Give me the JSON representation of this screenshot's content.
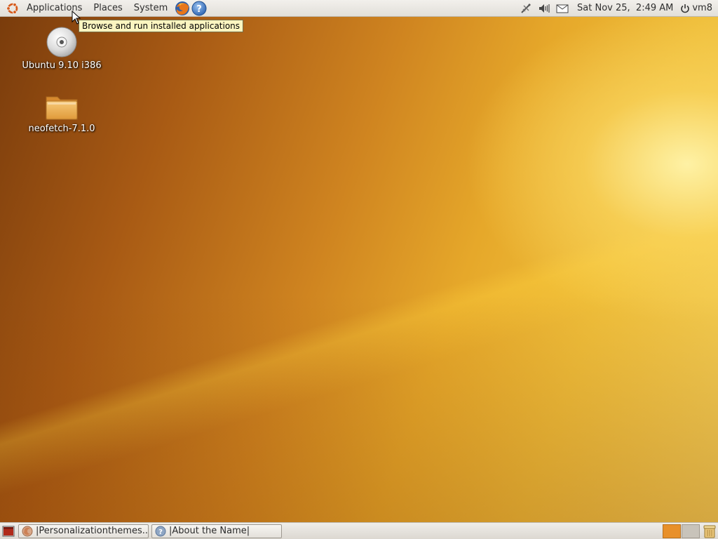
{
  "top_panel": {
    "menus": [
      "Applications",
      "Places",
      "System"
    ],
    "clock": "Sat Nov 25,  2:49 AM",
    "user": "vm8"
  },
  "tooltip": {
    "text": "Browse and run installed applications"
  },
  "desktop": {
    "icons": [
      {
        "label": "Ubuntu 9.10 i386",
        "icon": "cd-disc-icon"
      },
      {
        "label": "neofetch-7.1.0",
        "icon": "folder-icon"
      }
    ]
  },
  "bottom_panel": {
    "tasks": [
      {
        "label": "|Personalizationthemes...",
        "icon": "firefox-icon"
      },
      {
        "label": "|About the Name|",
        "icon": "help-icon"
      }
    ],
    "workspaces": [
      {
        "state": "active"
      },
      {
        "state": "inactive"
      }
    ]
  },
  "colors": {
    "panel": "#e8e5e0",
    "tooltip_bg": "#fbf5c0",
    "workspace_active": "#e8902a"
  }
}
